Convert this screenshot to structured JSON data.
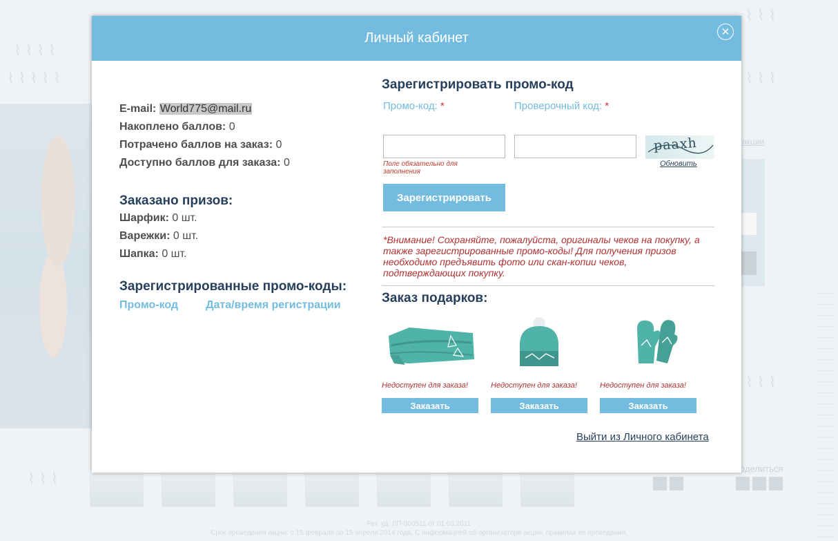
{
  "modal": {
    "title": "Личный кабинет",
    "close_symbol": "✕"
  },
  "account": {
    "email_label": "E-mail:",
    "email_value": "World775@mail.ru",
    "earned_label": "Накоплено баллов:",
    "earned_value": "0",
    "spent_label": "Потрачено баллов на заказ:",
    "spent_value": "0",
    "available_label": "Доступно баллов для заказа:",
    "available_value": "0"
  },
  "prizes": {
    "title": "Заказано призов:",
    "items": [
      {
        "label": "Шарфик:",
        "value": "0 шт."
      },
      {
        "label": "Варежки:",
        "value": "0 шт."
      },
      {
        "label": "Шапка:",
        "value": "0 шт."
      }
    ]
  },
  "registered_codes": {
    "title": "Зарегистрированные промо-коды:",
    "col_code": "Промо-код",
    "col_datetime": "Дата/время регистрации"
  },
  "register_form": {
    "title": "Зарегистрировать промо-код",
    "promo_label": "Промо-код:",
    "check_label": "Проверочный код:",
    "required_mark": "*",
    "promo_value": "",
    "check_value": "",
    "error_text": "Поле обязательно для заполнения",
    "captcha_text": "paaxh",
    "refresh_label": "Обновить",
    "submit_label": "Зарегистрировать"
  },
  "warning": "*Внимание! Сохраняйте, пожалуйста, оригиналы чеков на покупку, а также зарегистрированные промо-коды! Для получения призов необходимо предъявить фото или скан-копии чеков, подтверждающих покупку.",
  "gifts": {
    "title": "Заказ подарков:",
    "items": [
      {
        "name": "scarf",
        "status": "Недоступен для заказа!",
        "button": "Заказать"
      },
      {
        "name": "hat",
        "status": "Недоступен для заказа!",
        "button": "Заказать"
      },
      {
        "name": "mittens",
        "status": "Недоступен для заказа!",
        "button": "Заказать"
      }
    ]
  },
  "logout_label": "Выйти из Личного кабинета",
  "colors": {
    "accent": "#74bbe0",
    "title_dark": "#263f5a",
    "error": "#b03030",
    "gift_teal": "#4fb3a7"
  },
  "background": {
    "link_text": "акции",
    "button_text": "ся",
    "share_text": "оделиться",
    "footer_line1": "Рег. уд. ЛП-000511 от 01.03.2011",
    "footer_line2": "Срок проведения акции: с 15 февраля по 15 апреля 2014 года. С информацией об организаторе акции, правилах ее проведения,"
  }
}
